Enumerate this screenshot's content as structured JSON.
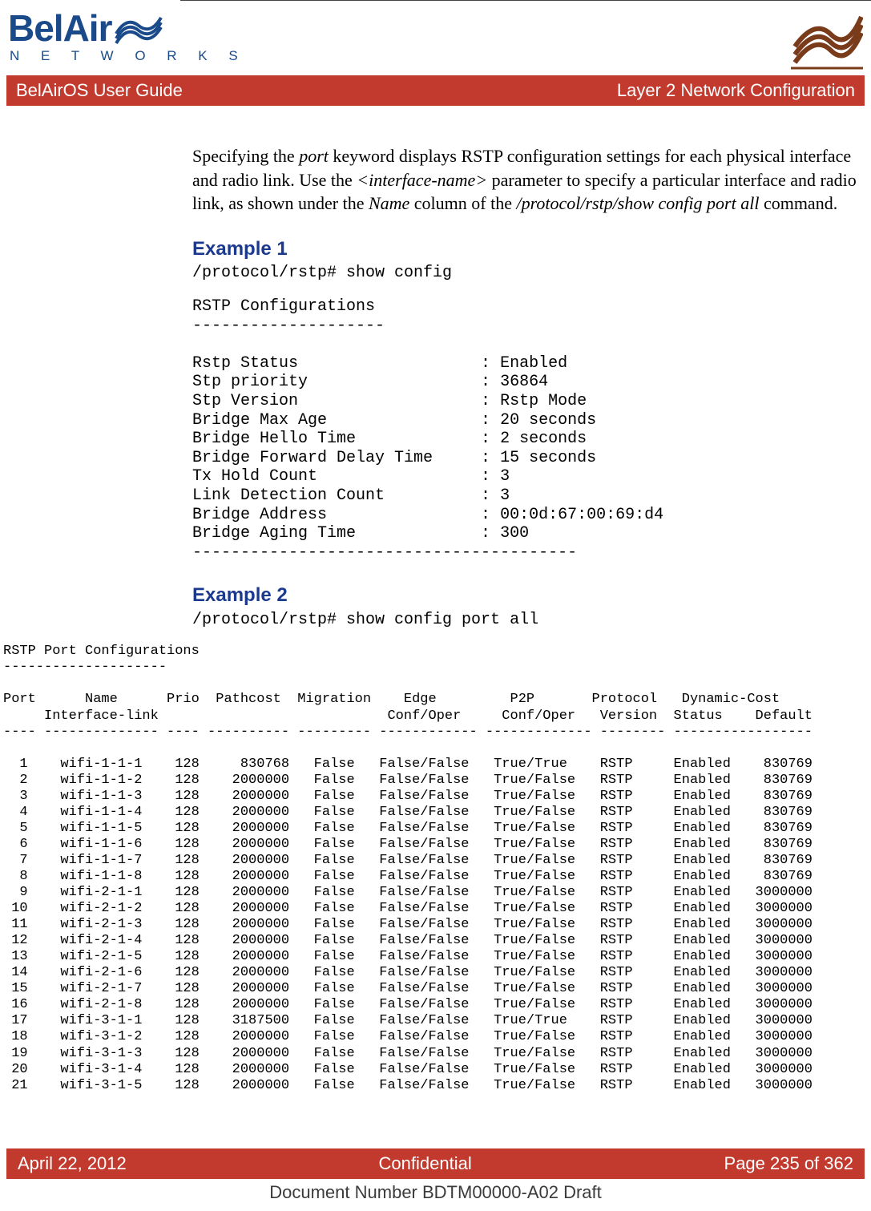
{
  "header": {
    "brand_top": "BelAir",
    "brand_bottom": "N E T W O R K S",
    "guide_title": "BelAirOS User Guide",
    "section_title": "Layer 2 Network Configuration"
  },
  "body": {
    "paragraph_parts": [
      "Specifying the ",
      "port",
      " keyword displays RSTP configuration settings for each physical interface and radio link. Use the ",
      "<interface-name>",
      " parameter to specify a particular interface and radio link, as shown under the ",
      "Name",
      " column of the ",
      "/protocol/rstp/show config port all",
      " command."
    ],
    "example1_title": "Example 1",
    "example1_cmd": "/protocol/rstp# show config",
    "example1_block": "RSTP Configurations\n--------------------\n\nRstp Status                   : Enabled\nStp priority                  : 36864\nStp Version                   : Rstp Mode\nBridge Max Age                : 20 seconds\nBridge Hello Time             : 2 seconds\nBridge Forward Delay Time     : 15 seconds\nTx Hold Count                 : 3\nLink Detection Count          : 3\nBridge Address                : 00:0d:67:00:69:d4\nBridge Aging Time             : 300\n----------------------------------------",
    "example2_title": "Example 2",
    "example2_cmd": "/protocol/rstp# show config port all"
  },
  "table": {
    "block": "RSTP Port Configurations\n--------------------\n\nPort      Name      Prio  Pathcost  Migration    Edge         P2P       Protocol   Dynamic-Cost\n     Interface-link                            Conf/Oper     Conf/Oper   Version  Status    Default\n---- -------------- ---- ---------- --------- ------------ ------------- -------- -----------------\n\n  1    wifi-1-1-1    128     830768   False   False/False   True/True    RSTP     Enabled    830769\n  2    wifi-1-1-2    128    2000000   False   False/False   True/False   RSTP     Enabled    830769\n  3    wifi-1-1-3    128    2000000   False   False/False   True/False   RSTP     Enabled    830769\n  4    wifi-1-1-4    128    2000000   False   False/False   True/False   RSTP     Enabled    830769\n  5    wifi-1-1-5    128    2000000   False   False/False   True/False   RSTP     Enabled    830769\n  6    wifi-1-1-6    128    2000000   False   False/False   True/False   RSTP     Enabled    830769\n  7    wifi-1-1-7    128    2000000   False   False/False   True/False   RSTP     Enabled    830769\n  8    wifi-1-1-8    128    2000000   False   False/False   True/False   RSTP     Enabled    830769\n  9    wifi-2-1-1    128    2000000   False   False/False   True/False   RSTP     Enabled   3000000\n 10    wifi-2-1-2    128    2000000   False   False/False   True/False   RSTP     Enabled   3000000\n 11    wifi-2-1-3    128    2000000   False   False/False   True/False   RSTP     Enabled   3000000\n 12    wifi-2-1-4    128    2000000   False   False/False   True/False   RSTP     Enabled   3000000\n 13    wifi-2-1-5    128    2000000   False   False/False   True/False   RSTP     Enabled   3000000\n 14    wifi-2-1-6    128    2000000   False   False/False   True/False   RSTP     Enabled   3000000\n 15    wifi-2-1-7    128    2000000   False   False/False   True/False   RSTP     Enabled   3000000\n 16    wifi-2-1-8    128    2000000   False   False/False   True/False   RSTP     Enabled   3000000\n 17    wifi-3-1-1    128    3187500   False   False/False   True/True    RSTP     Enabled   3000000\n 18    wifi-3-1-2    128    2000000   False   False/False   True/False   RSTP     Enabled   3000000\n 19    wifi-3-1-3    128    2000000   False   False/False   True/False   RSTP     Enabled   3000000\n 20    wifi-3-1-4    128    2000000   False   False/False   True/False   RSTP     Enabled   3000000\n 21    wifi-3-1-5    128    2000000   False   False/False   True/False   RSTP     Enabled   3000000"
  },
  "footer": {
    "date": "April 22, 2012",
    "confidential": "Confidential",
    "page": "Page 235 of 362",
    "doc_number": "Document Number BDTM00000-A02 Draft"
  }
}
